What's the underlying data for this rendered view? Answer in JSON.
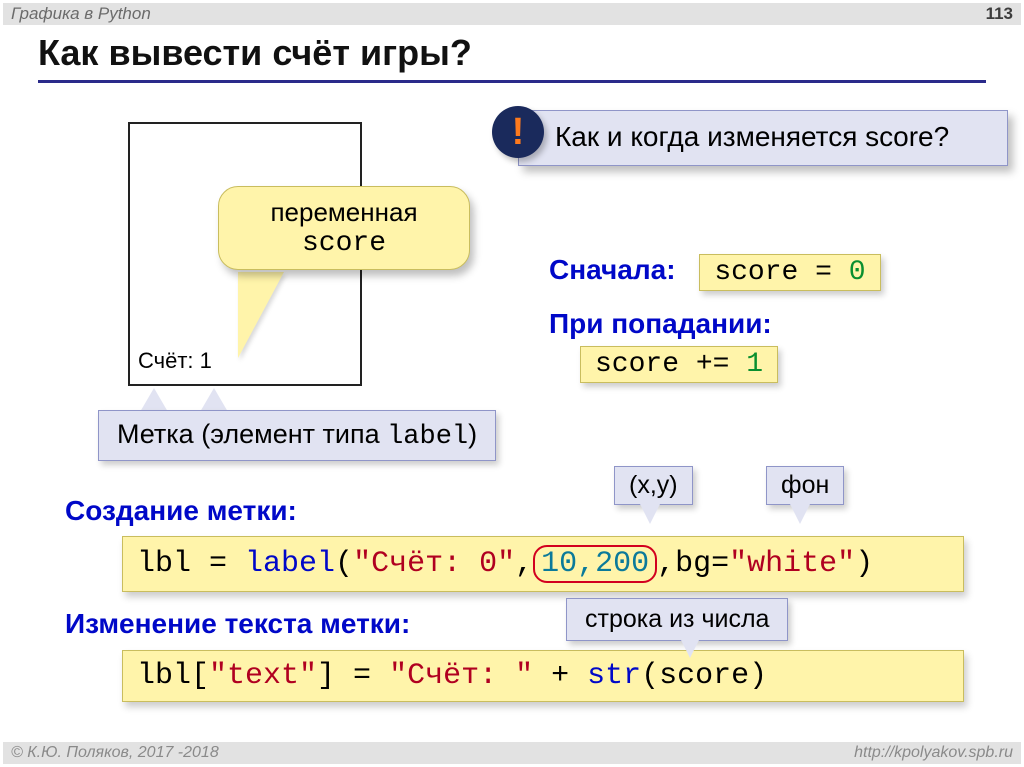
{
  "header": {
    "topic": "Графика в Python",
    "page": "113"
  },
  "title": "Как вывести счёт игры?",
  "window_label": "Счёт: 1",
  "bubble_var": {
    "line1": "переменная",
    "line2": "score"
  },
  "question": "Как и когда изменяется score?",
  "exmark": "!",
  "start_label": "Сначала:",
  "start_code": {
    "pre": "score = ",
    "val": "0"
  },
  "hit_label": "При попадании:",
  "hit_code": {
    "pre": "score += ",
    "val": "1"
  },
  "metka": {
    "pre": "Метка (элемент типа ",
    "mono": "label",
    "post": ")"
  },
  "tiny_xy": "(x,y)",
  "tiny_bg": "фон",
  "sec1": "Создание метки:",
  "sec2": "Изменение текста метки:",
  "code1": {
    "lbl": "lbl = ",
    "fn": "label",
    "s1": "(",
    "str": "\"Счёт: 0\"",
    "c1": ",",
    "nums": "10,200",
    "c2": ",bg=",
    "bg": "\"white\"",
    "s2": ")"
  },
  "code2": {
    "pre": "lbl[",
    "key": "\"text\"",
    "mid": "] = ",
    "str": "\"Счёт: \"",
    "plus": " + ",
    "fn": "str",
    "arg": "(score)"
  },
  "tiny_strnum": "строка из числа",
  "footer": {
    "left": "© К.Ю. Поляков, 2017 -2018",
    "right": "http://kpolyakov.spb.ru"
  }
}
